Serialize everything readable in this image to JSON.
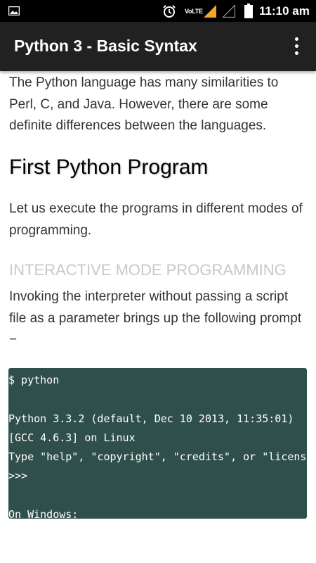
{
  "status_bar": {
    "image_icon": "image-icon",
    "alarm_icon": "alarm-clock-icon",
    "network_label": "VoLTE",
    "signal_icon": "signal-strength-icon",
    "battery_icon": "battery-icon",
    "time": "11:10 am"
  },
  "app_bar": {
    "title": "Python 3 - Basic Syntax",
    "menu_icon": "more-vert-icon"
  },
  "article": {
    "intro": "The Python language has many similarities to Perl, C, and Java. However, there are some definite differences between the languages.",
    "heading": "First Python Program",
    "paragraph": "Let us execute the programs in different modes of programming.",
    "subheading": "INTERACTIVE MODE PROGRAMMING",
    "paragraph2": "Invoking the interpreter without passing a script file as a parameter brings up the following prompt −",
    "code": "$ python\n\nPython 3.3.2 (default, Dec 10 2013, 11:35:01)\n[GCC 4.6.3] on Linux\nType \"help\", \"copyright\", \"credits\", or \"license\" for more information.\n>>>\n\nOn Windows:"
  },
  "colors": {
    "status_bar": "#000000",
    "app_bar": "#212121",
    "code_background": "#2f4f4b",
    "subheading": "#c8c8c8",
    "body_text": "#333333"
  }
}
